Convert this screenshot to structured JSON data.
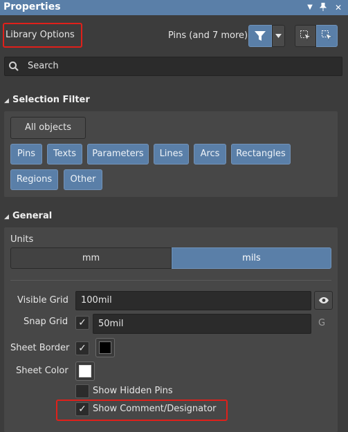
{
  "window": {
    "title": "Properties"
  },
  "header": {
    "mode_label": "Library Options",
    "filter_summary": "Pins (and 7 more)"
  },
  "search": {
    "placeholder": "Search"
  },
  "selection_filter": {
    "title": "Selection Filter",
    "all_objects": "All objects",
    "chips": [
      "Pins",
      "Texts",
      "Parameters",
      "Lines",
      "Arcs",
      "Rectangles",
      "Regions",
      "Other"
    ]
  },
  "general": {
    "title": "General",
    "units_label": "Units",
    "units_options": [
      "mm",
      "mils"
    ],
    "units_selected": "mils",
    "visible_grid_label": "Visible Grid",
    "visible_grid_value": "100mil",
    "snap_grid_label": "Snap Grid",
    "snap_grid_value": "50mil",
    "snap_grid_suffix": "G",
    "sheet_border_label": "Sheet Border",
    "sheet_color_label": "Sheet Color",
    "show_hidden_pins_label": "Show Hidden Pins",
    "show_comment_label": "Show Comment/Designator"
  },
  "colors": {
    "accent": "#5a7fa8",
    "highlight_box": "#e0201a",
    "sheet_border_color": "#000000",
    "sheet_color": "#ffffff"
  },
  "icons": [
    "menu-arrow-icon",
    "pin-icon",
    "close-icon",
    "filter-icon",
    "chevron-down-icon",
    "select-inside-icon",
    "select-touching-icon",
    "search-icon",
    "eye-icon",
    "check-icon"
  ]
}
